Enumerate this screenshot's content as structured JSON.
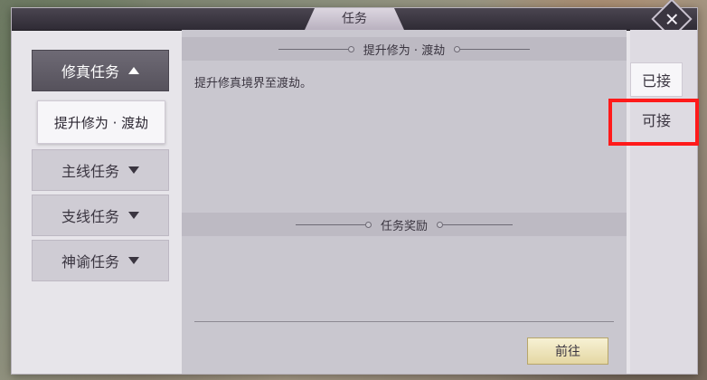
{
  "window": {
    "title": "任务",
    "close_icon": "close-icon"
  },
  "categories": [
    {
      "label": "修真任务",
      "expanded": true
    },
    {
      "label": "主线任务",
      "expanded": false
    },
    {
      "label": "支线任务",
      "expanded": false
    },
    {
      "label": "神谕任务",
      "expanded": false
    }
  ],
  "selected_quest": {
    "label": "提升修为 · 渡劫"
  },
  "detail": {
    "quest_heading": "提升修为 · 渡劫",
    "quest_desc": "提升修真境界至渡劫。",
    "reward_heading": "任务奖励",
    "go_button": "前往"
  },
  "tabs": [
    {
      "label": "已接",
      "active": true
    },
    {
      "label": "可接",
      "active": false
    }
  ],
  "colors": {
    "highlight": "#ff1a1a",
    "go_button": "#e4d7a3"
  }
}
